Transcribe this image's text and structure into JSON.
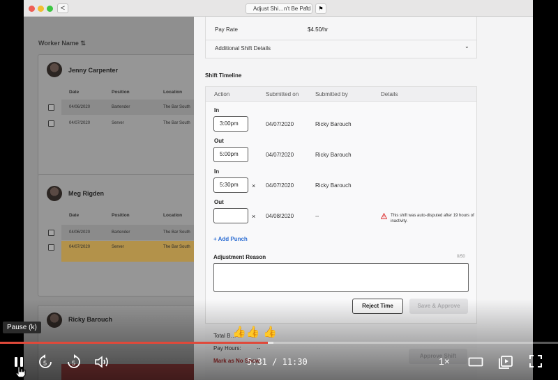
{
  "browser": {
    "tab_title": "Adjust Shi…n't Be Paid",
    "back": "<",
    "tab_chevron": "⌃",
    "flag": "⚑"
  },
  "left": {
    "header": "Worker Name ⇅",
    "col_date": "Date",
    "col_position": "Position",
    "col_location": "Location",
    "workers": [
      {
        "name": "Jenny Carpenter",
        "rows": [
          {
            "date": "04/06/2020",
            "position": "Bartender",
            "location": "The Bar South"
          },
          {
            "date": "04/07/2020",
            "position": "Server",
            "location": "The Bar South"
          }
        ]
      },
      {
        "name": "Meg Rigden",
        "rows": [
          {
            "date": "04/06/2020",
            "position": "Bartender",
            "location": "The Bar South"
          },
          {
            "date": "04/07/2020",
            "position": "Server",
            "location": "The Bar South"
          }
        ]
      },
      {
        "name": "Ricky Barouch",
        "rows": []
      }
    ]
  },
  "panel": {
    "pay_rate_label": "Pay Rate",
    "pay_rate_value": "$4.50/hr",
    "additional_details": "Additional Shift Details",
    "chevron": "⌄",
    "timeline_title": "Shift Timeline",
    "cols": {
      "action": "Action",
      "submitted_on": "Submitted on",
      "submitted_by": "Submitted by",
      "details": "Details"
    },
    "punches": [
      {
        "action": "In",
        "time": "3:00pm",
        "removable": false,
        "date": "04/07/2020",
        "by": "Ricky Barouch"
      },
      {
        "action": "Out",
        "time": "5:00pm",
        "removable": false,
        "date": "04/07/2020",
        "by": "Ricky Barouch"
      },
      {
        "action": "In",
        "time": "5:30pm",
        "removable": true,
        "date": "04/07/2020",
        "by": "Ricky Barouch"
      },
      {
        "action": "Out",
        "time": "",
        "removable": true,
        "date": "04/08/2020",
        "by": "--"
      }
    ],
    "remove_glyph": "×",
    "warning": "This shift was auto-disputed after 19 hours of inactivity.",
    "add_punch": "+ Add Punch",
    "adjustment_reason": "Adjustment Reason",
    "char_count": "0/50",
    "reject_btn": "Reject Time",
    "save_btn": "Save & Approve",
    "total_label": "Total B…",
    "pay_hours_label": "Pay Hours:",
    "pay_hours_value": "--",
    "mark_no_show": "Mark as No Show",
    "approve_shift": "Approve Shift"
  },
  "player": {
    "tooltip": "Pause (k)",
    "current_time": "5:31",
    "separator": "/",
    "duration": "11:30",
    "speed": "1×",
    "rewind_seconds": "5",
    "forward_seconds": "5",
    "played_fraction": 0.48,
    "buffered_fraction": 0.49,
    "reaction": "👍👍 👍"
  },
  "colors": {
    "accent_red": "#e0493a",
    "link_blue": "#2f6fd3",
    "highlight_row": "#b3924a"
  }
}
